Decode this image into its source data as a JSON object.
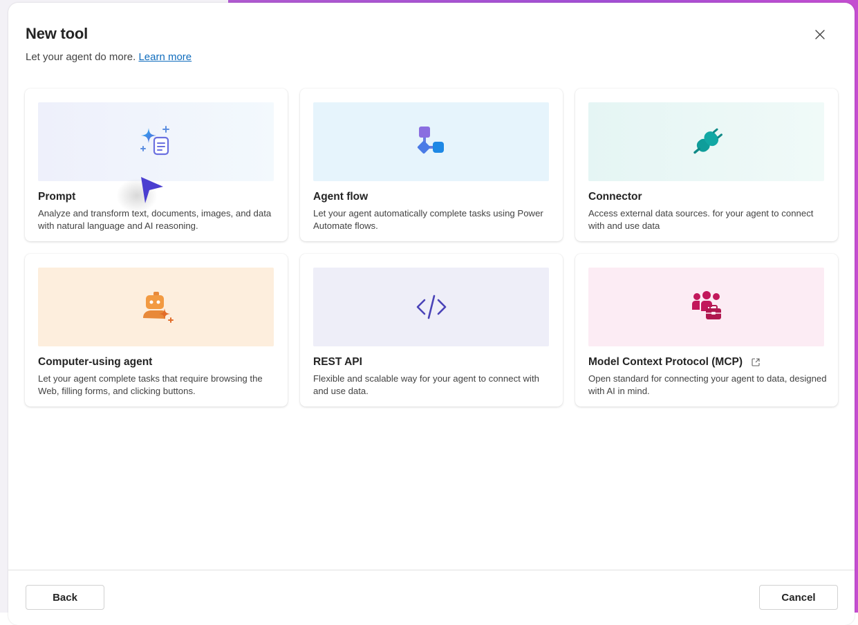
{
  "dialog": {
    "title": "New tool",
    "subtitle": "Let your agent do more.",
    "learn_more": "Learn more"
  },
  "cards": [
    {
      "title": "Prompt",
      "description": "Analyze and transform text, documents, images, and data with natural language and AI reasoning.",
      "icon": "prompt-sparkle-icon",
      "banner_color": "#eef0fb"
    },
    {
      "title": "Agent flow",
      "description": "Let your agent automatically complete tasks using Power Automate flows.",
      "icon": "flow-icon",
      "banner_color": "#e6f4fc"
    },
    {
      "title": "Connector",
      "description": "Access external data sources. for your agent to connect with and use data",
      "icon": "plug-icon",
      "banner_color": "#e5f5f4"
    },
    {
      "title": "Computer-using agent",
      "description": "Let your agent complete tasks that require browsing the Web, filling forms, and clicking buttons.",
      "icon": "bot-sparkle-icon",
      "banner_color": "#fdeedd"
    },
    {
      "title": "REST API",
      "description": "Flexible and scalable way for your agent to connect with and use data.",
      "icon": "code-icon",
      "banner_color": "#eeeef8"
    },
    {
      "title": "Model Context Protocol (MCP)",
      "description": "Open standard for connecting your agent to data, designed with AI in mind.",
      "icon": "people-toolbox-icon",
      "banner_color": "#fcecf4"
    }
  ],
  "footer": {
    "back_label": "Back",
    "cancel_label": "Cancel"
  },
  "colors": {
    "accent_link": "#0f6cbd",
    "background_gradient": "#b05ad0"
  }
}
